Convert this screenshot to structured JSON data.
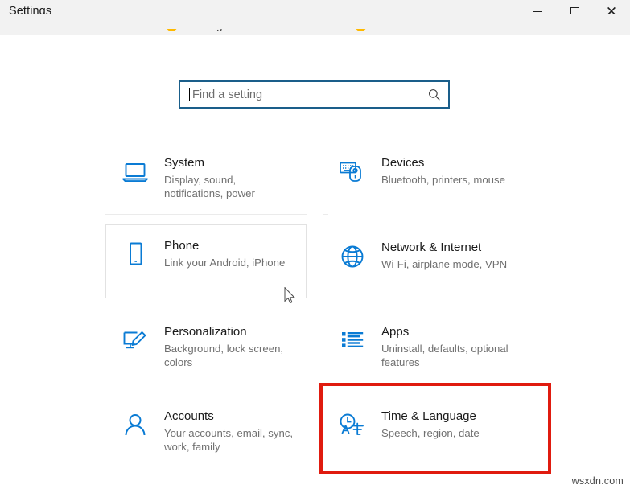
{
  "window": {
    "title": "Settings",
    "controls": {
      "minimize": "minimize-button",
      "maximize": "maximize-button",
      "close": "close-button"
    }
  },
  "account_strip": {
    "items": [
      {
        "label": "Sign in",
        "badge": "warning-icon"
      },
      {
        "label": "Attention needed",
        "badge": "warning-icon"
      }
    ]
  },
  "search": {
    "placeholder": "Find a setting",
    "value": "",
    "icon": "search-icon"
  },
  "tiles": [
    {
      "title": "System",
      "desc": "Display, sound, notifications, power",
      "icon": "laptop-icon",
      "state": "normal"
    },
    {
      "title": "Devices",
      "desc": "Bluetooth, printers, mouse",
      "icon": "keyboard-mouse-icon",
      "state": "normal"
    },
    {
      "title": "Phone",
      "desc": "Link your Android, iPhone",
      "icon": "phone-icon",
      "state": "hovered"
    },
    {
      "title": "Network & Internet",
      "desc": "Wi-Fi, airplane mode, VPN",
      "icon": "globe-icon",
      "state": "normal"
    },
    {
      "title": "Personalization",
      "desc": "Background, lock screen, colors",
      "icon": "paintbrush-monitor-icon",
      "state": "normal"
    },
    {
      "title": "Apps",
      "desc": "Uninstall, defaults, optional features",
      "icon": "app-list-icon",
      "state": "normal"
    },
    {
      "title": "Accounts",
      "desc": "Your accounts, email, sync, work, family",
      "icon": "person-icon",
      "state": "normal"
    },
    {
      "title": "Time & Language",
      "desc": "Speech, region, date",
      "icon": "clock-language-icon",
      "state": "highlighted"
    }
  ],
  "annotation": {
    "target": "Time & Language",
    "color": "#e01b0f"
  },
  "watermark": "wsxdn.com",
  "colors": {
    "accent_blue": "#0a7bd4",
    "highlight_red": "#e01b0f",
    "warning_yellow": "#ffb900",
    "titlebar_bg": "#f2f2f2",
    "search_border": "#1a5e8a"
  }
}
